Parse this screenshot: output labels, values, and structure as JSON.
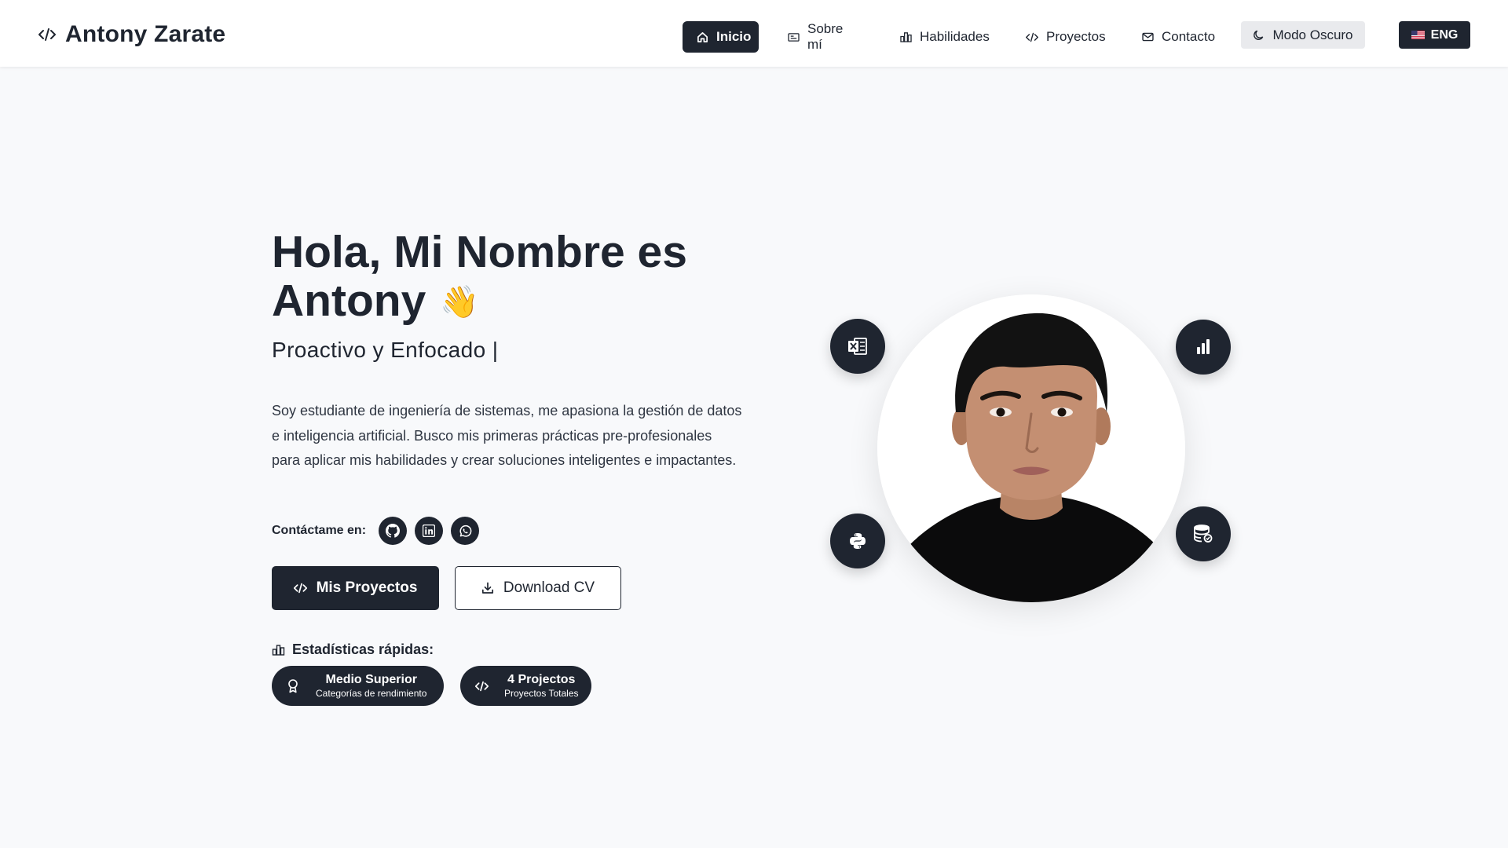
{
  "brand": {
    "name": "Antony Zarate",
    "icon": "code-icon"
  },
  "nav": {
    "items": [
      {
        "label": "Inicio",
        "icon": "home-icon",
        "active": true
      },
      {
        "label": "Sobre mí",
        "icon": "id-card-icon",
        "active": false
      },
      {
        "label": "Habilidades",
        "icon": "bar-chart-icon",
        "active": false
      },
      {
        "label": "Proyectos",
        "icon": "code-icon",
        "active": false
      },
      {
        "label": "Contacto",
        "icon": "mail-icon",
        "active": false
      }
    ],
    "dark_mode_label": "Modo Oscuro",
    "language_label": "ENG"
  },
  "hero": {
    "title_line1": "Hola, Mi Nombre es",
    "title_line2": "Antony",
    "wave": "👋",
    "subtitle": "Proactivo y Enfocado |",
    "description": "Soy estudiante de ingeniería de sistemas, me apasiona la gestión de datos e inteligencia artificial. Busco mis primeras prácticas pre-profesionales para aplicar mis habilidades y crear soluciones inteligentes e impactantes.",
    "contact_label": "Contáctame en:",
    "socials": [
      "github-icon",
      "linkedin-icon",
      "whatsapp-icon"
    ],
    "projects_button": "Mis Proyectos",
    "cv_button": "Download CV"
  },
  "stats": {
    "title": "Estadísticas rápidas:",
    "items": [
      {
        "main": "Medio Superior",
        "sub": "Categorías de rendimiento",
        "icon": "award-icon"
      },
      {
        "main": "4 Projectos",
        "sub": "Proyectos Totales",
        "icon": "code-icon"
      }
    ]
  },
  "skills_orbit": [
    "excel-icon",
    "power-bi-icon",
    "python-icon",
    "database-icon"
  ],
  "colors": {
    "primary": "#1f2530",
    "background": "#f8f9fb",
    "header": "#ffffff"
  }
}
